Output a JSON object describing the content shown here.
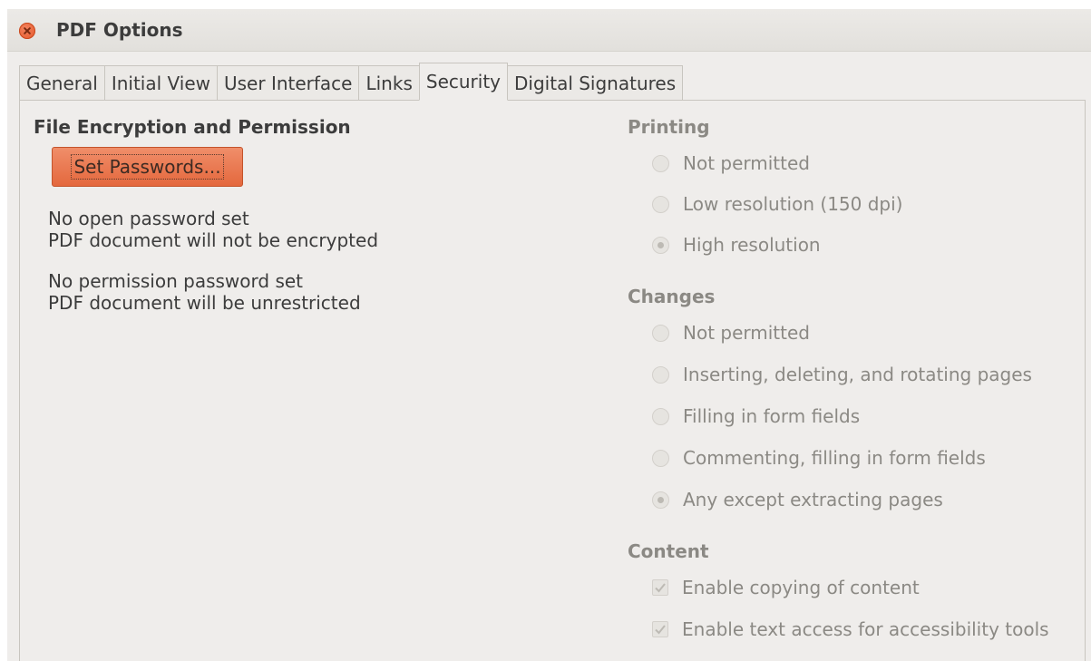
{
  "window": {
    "title": "PDF Options"
  },
  "tabs": [
    {
      "label": "General"
    },
    {
      "label": "Initial View"
    },
    {
      "label": "User Interface"
    },
    {
      "label": "Links"
    },
    {
      "label": "Security",
      "active": true
    },
    {
      "label": "Digital Signatures"
    }
  ],
  "encryption": {
    "heading": "File Encryption and Permission",
    "set_passwords_label": "Set Passwords...",
    "open_pw_line1": "No open password set",
    "open_pw_line2": "PDF document will not be encrypted",
    "perm_pw_line1": "No permission password set",
    "perm_pw_line2": "PDF document will be unrestricted"
  },
  "printing": {
    "heading": "Printing",
    "options": [
      {
        "label": "Not permitted",
        "selected": false
      },
      {
        "label": "Low resolution (150 dpi)",
        "selected": false
      },
      {
        "label": "High resolution",
        "selected": true
      }
    ]
  },
  "changes": {
    "heading": "Changes",
    "options": [
      {
        "label": "Not permitted",
        "selected": false
      },
      {
        "label": "Inserting, deleting, and rotating pages",
        "selected": false
      },
      {
        "label": "Filling in form fields",
        "selected": false
      },
      {
        "label": "Commenting, filling in form fields",
        "selected": false
      },
      {
        "label": "Any except extracting pages",
        "selected": true
      }
    ]
  },
  "content": {
    "heading": "Content",
    "options": [
      {
        "label": "Enable copying of content",
        "checked": true
      },
      {
        "label": "Enable text access for accessibility tools",
        "checked": true
      }
    ]
  },
  "colors": {
    "accent_button": "#e4683d",
    "disabled_text": "#8b8984",
    "window_bg": "#efedeb",
    "close_button": "#e4572a"
  }
}
